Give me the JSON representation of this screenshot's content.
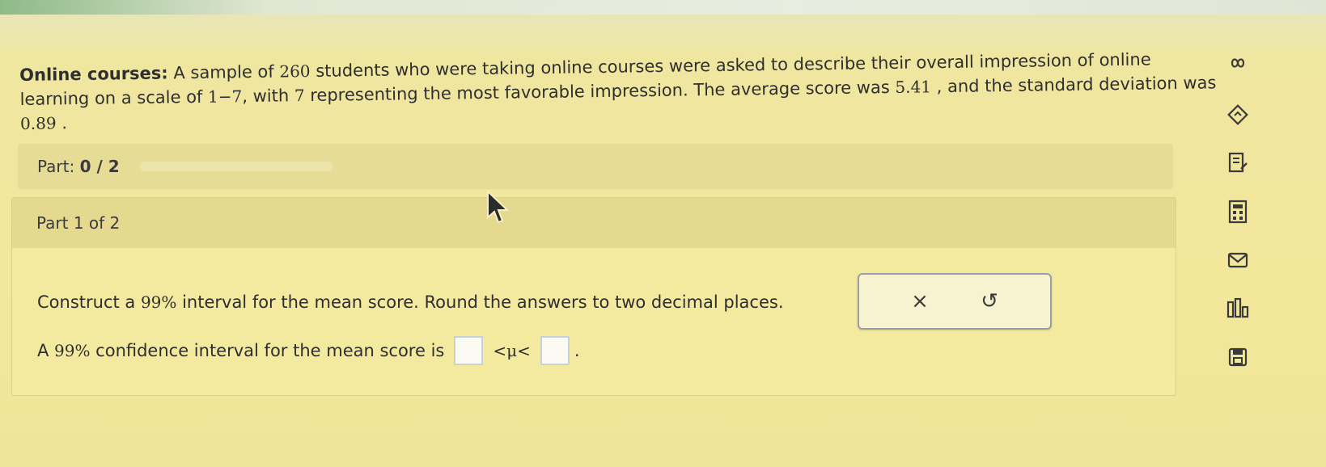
{
  "problem": {
    "lead": "Online courses:",
    "text_1": " A sample of ",
    "n": "260",
    "text_2": " students who were taking online courses were asked to describe their overall impression of online learning on a scale of ",
    "scale_low": "1",
    "dash": "−",
    "scale_high": "7",
    "text_3": ", with ",
    "favorable": "7",
    "text_4": " representing the most favorable impression. The average score was ",
    "mean": "5.41",
    "text_5": " , and the standard deviation was ",
    "sd": "0.89",
    "text_6": " ."
  },
  "part_bar": {
    "label": "Part:",
    "progress": "0 / 2",
    "progress_fraction": 0
  },
  "part_header": "Part 1 of 2",
  "question": {
    "text_1": "Construct a ",
    "percent": "99%",
    "text_2": " interval for the mean score. Round the answers to two decimal places."
  },
  "answer": {
    "text_1": "A ",
    "percent": "99%",
    "text_2": " confidence interval for the mean score is",
    "lower_value": "",
    "mu_expr": "<μ<",
    "upper_value": "",
    "end": "."
  },
  "tools": {
    "clear_symbol": "×",
    "undo_symbol": "↺"
  },
  "sidebar_icons": [
    "infinity-icon",
    "diamond-arrow-icon",
    "document-edit-icon",
    "calculator-icon",
    "mail-icon",
    "bar-chart-icon",
    "save-icon"
  ],
  "colors": {
    "background": "#f3e79b",
    "part_bar": "#e7dc95",
    "part_header": "#e5d990",
    "input_border": "#c7d2d8",
    "text": "#2e2e2e"
  }
}
